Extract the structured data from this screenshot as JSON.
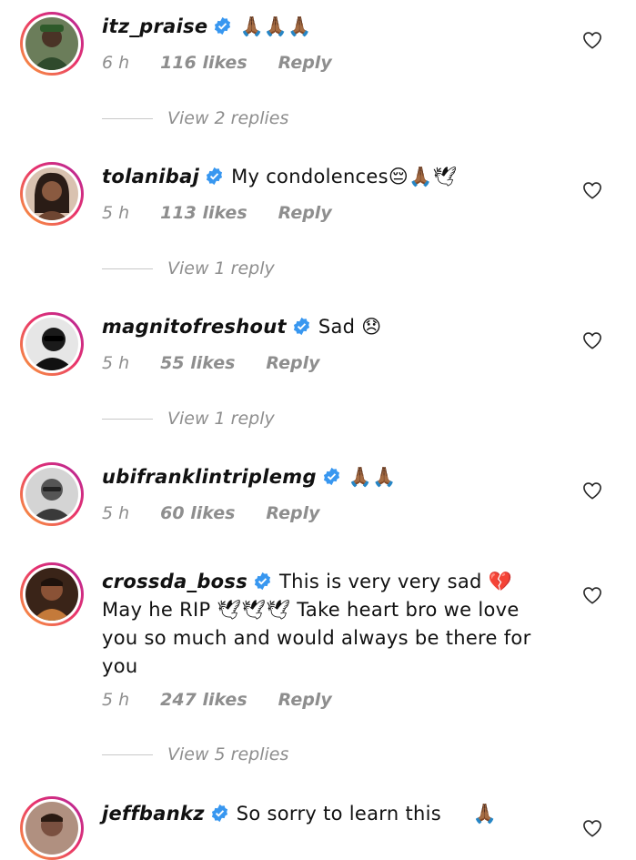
{
  "comments": [
    {
      "username": "itz_praise",
      "text": "🙏🏾🙏🏾🙏🏾",
      "time": "6 h",
      "likes": "116 likes",
      "reply_label": "Reply",
      "view_replies": "View 2 replies",
      "avatar_color": "#3d4a33"
    },
    {
      "username": "tolanibaj",
      "text": "My condolences😔🙏🏾🕊",
      "time": "5 h",
      "likes": "113 likes",
      "reply_label": "Reply",
      "view_replies": "View 1 reply",
      "avatar_color": "#5a3a30"
    },
    {
      "username": "magnitofreshout",
      "text": "Sad 😞",
      "time": "5 h",
      "likes": "55 likes",
      "reply_label": "Reply",
      "view_replies": "View 1 reply",
      "avatar_color": "#1c1c1c"
    },
    {
      "username": "ubifranklintriplemg",
      "text": "🙏🏾🙏🏾",
      "time": "5 h",
      "likes": "60 likes",
      "reply_label": "Reply",
      "view_replies": "",
      "avatar_color": "#bdbdbd"
    },
    {
      "username": "crossda_boss",
      "text": "This is very very sad 💔 May he RIP 🕊🕊🕊 Take heart bro we love you so much and would always be there for you",
      "time": "5 h",
      "likes": "247 likes",
      "reply_label": "Reply",
      "view_replies": "View 5 replies",
      "avatar_color": "#7a4a30"
    },
    {
      "username": "jeffbankz",
      "text": "So sorry to learn this     🙏🏾",
      "time": "",
      "likes": "",
      "reply_label": "",
      "view_replies": "",
      "avatar_color": "#8a6a55"
    }
  ],
  "colors": {
    "verified": "#3897f0",
    "meta": "#8e8e8e",
    "divider": "#c8c8c8"
  },
  "icons": {
    "verified": "verified-badge-icon",
    "like": "heart-outline-icon"
  }
}
